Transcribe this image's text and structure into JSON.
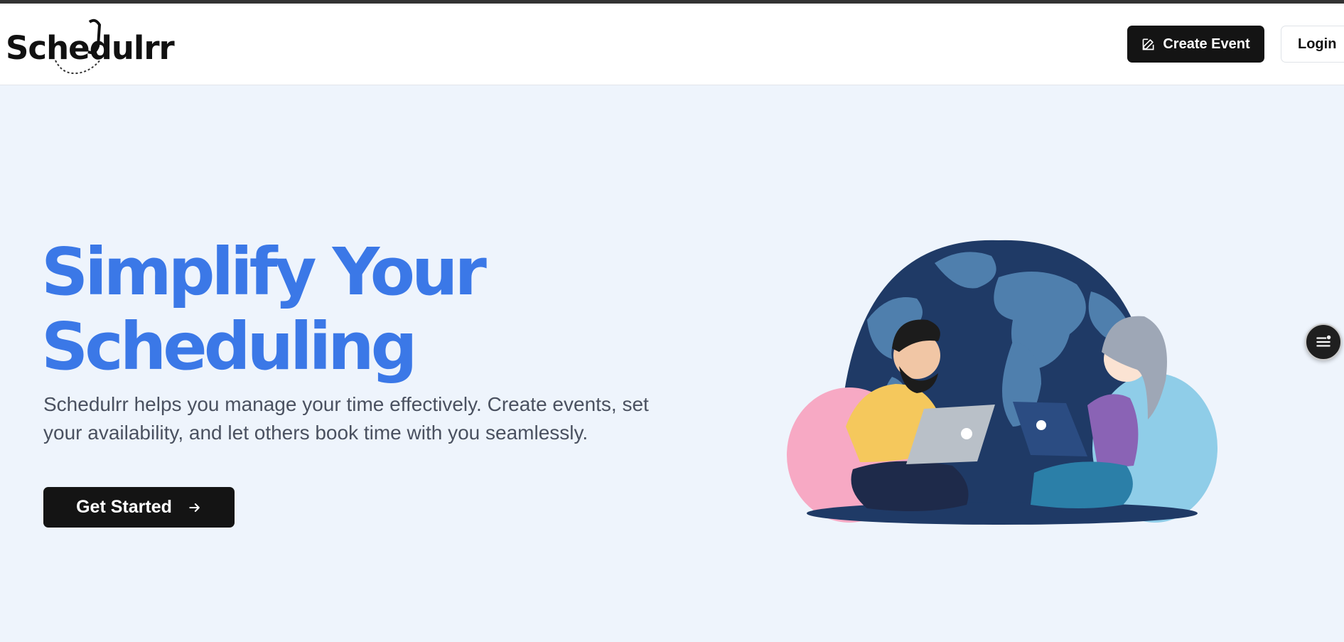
{
  "header": {
    "logo_text": "Schedulrr",
    "create_event_label": "Create Event",
    "login_label": "Login"
  },
  "hero": {
    "title_line1": "Simplify Your",
    "title_line2": "Scheduling",
    "description": "Schedulrr helps you manage your time effectively. Create events, set your availability, and let others book time with you seamlessly.",
    "cta_label": "Get Started"
  },
  "icons": {
    "edit": "edit-icon",
    "arrow": "arrow-right-icon",
    "menu": "menu-icon"
  },
  "colors": {
    "accent": "#3b78e7",
    "dark": "#141414",
    "background": "#eef4fc"
  }
}
